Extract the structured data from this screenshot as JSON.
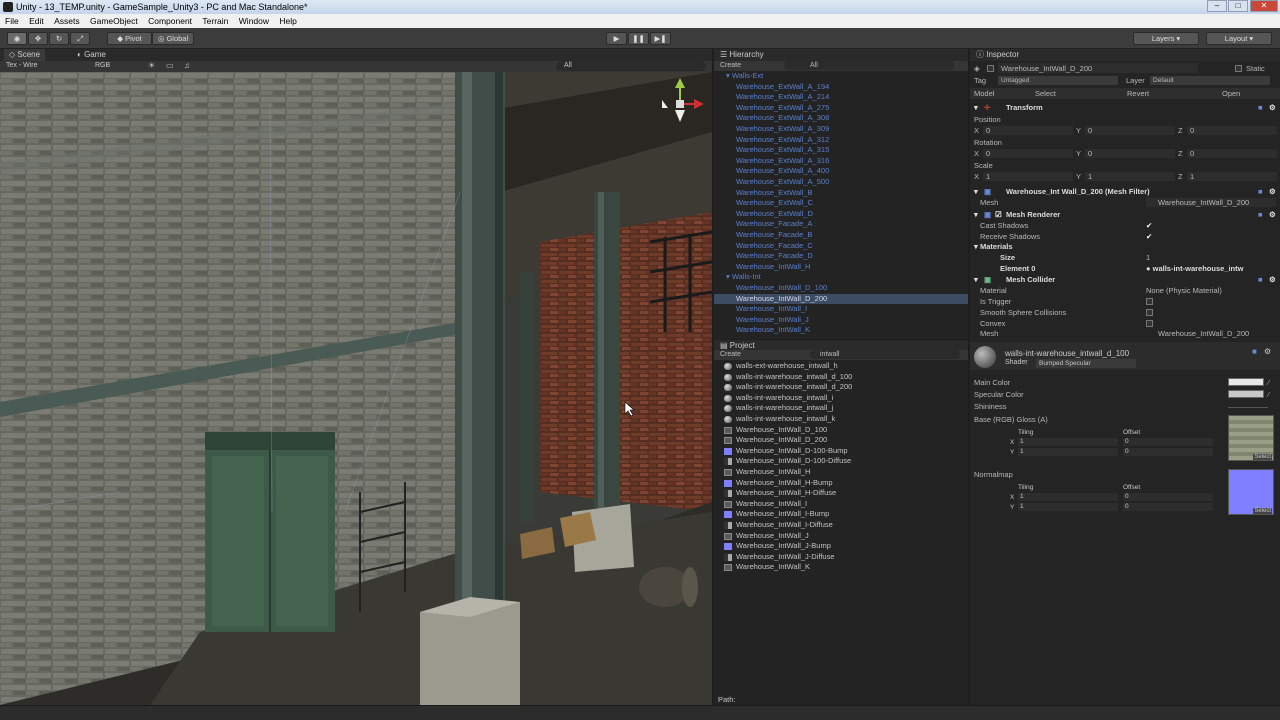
{
  "window": {
    "title": "Unity - 13_TEMP.unity - GameSample_Unity3 - PC and Mac Standalone*",
    "controls": [
      "–",
      "□",
      "✕"
    ]
  },
  "menu": [
    "File",
    "Edit",
    "Assets",
    "GameObject",
    "Component",
    "Terrain",
    "Window",
    "Help"
  ],
  "toolbar": {
    "pivot": "Pivot",
    "global": "Global",
    "layers": "Layers",
    "layout": "Layout"
  },
  "scene": {
    "tab_scene": "Scene",
    "tab_game": "Game",
    "render_mode": "Tex - Wire",
    "color_mode": "RGB",
    "search": "All"
  },
  "hierarchy": {
    "title": "Hierarchy",
    "create": "Create",
    "search": "All",
    "items": [
      {
        "label": "Walls-Ext",
        "group": true
      },
      {
        "label": "Warehouse_ExtWall_A_194"
      },
      {
        "label": "Warehouse_ExtWall_A_214"
      },
      {
        "label": "Warehouse_ExtWall_A_275"
      },
      {
        "label": "Warehouse_ExtWall_A_308"
      },
      {
        "label": "Warehouse_ExtWall_A_309"
      },
      {
        "label": "Warehouse_ExtWall_A_312"
      },
      {
        "label": "Warehouse_ExtWall_A_315"
      },
      {
        "label": "Warehouse_ExtWall_A_316"
      },
      {
        "label": "Warehouse_ExtWall_A_400"
      },
      {
        "label": "Warehouse_ExtWall_A_500"
      },
      {
        "label": "Warehouse_ExtWall_B"
      },
      {
        "label": "Warehouse_ExtWall_C"
      },
      {
        "label": "Warehouse_ExtWall_D"
      },
      {
        "label": "Warehouse_Facade_A"
      },
      {
        "label": "Warehouse_Facade_B"
      },
      {
        "label": "Warehouse_Facade_C"
      },
      {
        "label": "Warehouse_Facade_D"
      },
      {
        "label": "Warehouse_IntWall_H"
      },
      {
        "label": "Walls-Int",
        "group": true
      },
      {
        "label": "Warehouse_IntWall_D_100"
      },
      {
        "label": "Warehouse_IntWall_D_200",
        "selected": true
      },
      {
        "label": "Warehouse_IntWall_I"
      },
      {
        "label": "Warehouse_IntWall_J"
      },
      {
        "label": "Warehouse_IntWall_K"
      }
    ]
  },
  "project": {
    "title": "Project",
    "create": "Create",
    "search": "intwall",
    "path_label": "Path:",
    "items": [
      {
        "label": "walls-ext-warehouse_intwall_h",
        "icon": "material-icon"
      },
      {
        "label": "walls-int-warehouse_intwall_d_100",
        "icon": "material-icon"
      },
      {
        "label": "walls-int-warehouse_intwall_d_200",
        "icon": "material-icon"
      },
      {
        "label": "walls-int-warehouse_intwall_i",
        "icon": "material-icon"
      },
      {
        "label": "walls-int-warehouse_intwall_j",
        "icon": "material-icon"
      },
      {
        "label": "walls-int-warehouse_intwall_k",
        "icon": "material-icon"
      },
      {
        "label": "Warehouse_IntWall_D_100",
        "icon": "mesh-icon"
      },
      {
        "label": "Warehouse_IntWall_D_200",
        "icon": "mesh-icon"
      },
      {
        "label": "Warehouse_IntWall_D-100-Bump",
        "icon": "normalmap-icon"
      },
      {
        "label": "Warehouse_IntWall_D-100-Diffuse",
        "icon": "texture-icon"
      },
      {
        "label": "Warehouse_IntWall_H",
        "icon": "mesh-icon"
      },
      {
        "label": "Warehouse_IntWall_H-Bump",
        "icon": "normalmap-icon"
      },
      {
        "label": "Warehouse_IntWall_H-Diffuse",
        "icon": "texture-icon"
      },
      {
        "label": "Warehouse_IntWall_I",
        "icon": "mesh-icon"
      },
      {
        "label": "Warehouse_IntWall_I-Bump",
        "icon": "normalmap-icon"
      },
      {
        "label": "Warehouse_IntWall_I-Diffuse",
        "icon": "texture-icon"
      },
      {
        "label": "Warehouse_IntWall_J",
        "icon": "mesh-icon"
      },
      {
        "label": "Warehouse_IntWall_J-Bump",
        "icon": "normalmap-icon"
      },
      {
        "label": "Warehouse_IntWall_J-Diffuse",
        "icon": "texture-icon"
      },
      {
        "label": "Warehouse_IntWall_K",
        "icon": "mesh-icon"
      }
    ]
  },
  "inspector": {
    "title": "Inspector",
    "object_name": "Warehouse_IntWall_D_200",
    "static_label": "Static",
    "tag_label": "Tag",
    "tag_value": "Untagged",
    "layer_label": "Layer",
    "layer_value": "Default",
    "model_label": "Model",
    "model_select": "Select",
    "model_revert": "Revert",
    "model_open": "Open",
    "transform": {
      "title": "Transform",
      "position_label": "Position",
      "position": [
        "0",
        "0",
        "0"
      ],
      "rotation_label": "Rotation",
      "rotation": [
        "0",
        "0",
        "0"
      ],
      "scale_label": "Scale",
      "scale": [
        "1",
        "1",
        "1"
      ],
      "x": "X",
      "y": "Y",
      "z": "Z"
    },
    "mesh_filter": {
      "title": "Warehouse_Int Wall_D_200 (Mesh Filter)",
      "mesh_label": "Mesh",
      "mesh_value": "Warehouse_IntWall_D_200"
    },
    "mesh_renderer": {
      "title": "Mesh Renderer",
      "cast_shadows": "Cast Shadows",
      "receive_shadows": "Receive Shadows",
      "materials": "Materials",
      "size_label": "Size",
      "size_value": "1",
      "element0_label": "Element 0",
      "element0_value": "walls-int-warehouse_intw"
    },
    "mesh_collider": {
      "title": "Mesh Collider",
      "material_label": "Material",
      "material_value": "None (Physic Material)",
      "is_trigger": "Is Trigger",
      "smooth_sphere": "Smooth Sphere Collisions",
      "convex": "Convex",
      "mesh_label": "Mesh",
      "mesh_value": "Warehouse_IntWall_D_200"
    },
    "material": {
      "name": "walls-int-warehouse_intwall_d_100",
      "shader_label": "Shader",
      "shader_value": "Bumped Specular",
      "main_color": "Main Color",
      "specular_color": "Specular Color",
      "shininess": "Shininess",
      "base_label": "Base (RGB) Gloss (A)",
      "tiling": "Tiling",
      "offset": "Offset",
      "tiling_x": "1",
      "tiling_y": "1",
      "offset_x": "0",
      "offset_y": "0",
      "normalmap": "Normalmap",
      "n_tiling_x": "1",
      "n_tiling_y": "1",
      "n_offset_x": "0",
      "n_offset_y": "0",
      "select": "Select"
    }
  }
}
